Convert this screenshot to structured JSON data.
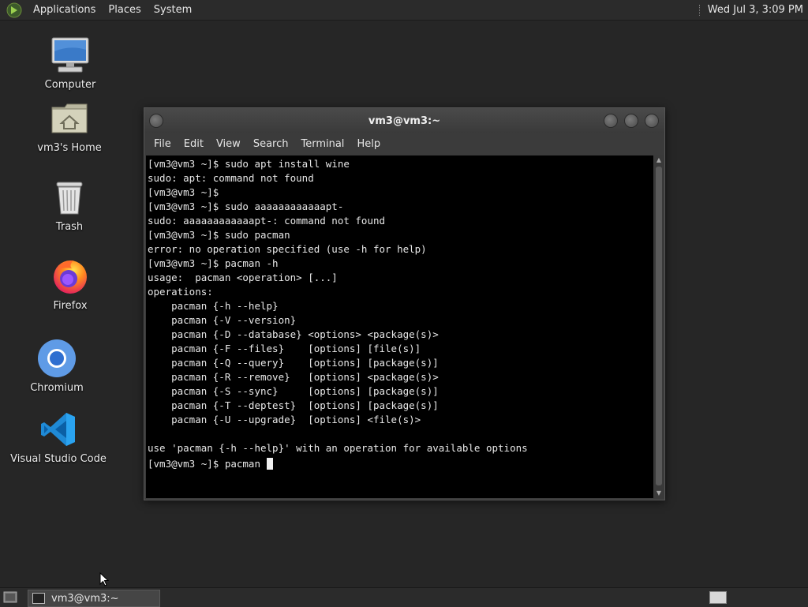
{
  "top_panel": {
    "menus": [
      "Applications",
      "Places",
      "System"
    ],
    "clock": "Wed Jul  3,  3:09 PM"
  },
  "desktop_icons": [
    {
      "label": "Computer",
      "icon": "computer-icon"
    },
    {
      "label": "vm3's Home",
      "icon": "home-folder-icon"
    },
    {
      "label": "Trash",
      "icon": "trash-icon"
    },
    {
      "label": "Firefox",
      "icon": "firefox-icon"
    },
    {
      "label": "Chromium",
      "icon": "chromium-icon"
    },
    {
      "label": "Visual Studio Code",
      "icon": "vscode-icon"
    }
  ],
  "terminal": {
    "title": "vm3@vm3:~",
    "menu": [
      "File",
      "Edit",
      "View",
      "Search",
      "Terminal",
      "Help"
    ],
    "lines": [
      "[vm3@vm3 ~]$ sudo apt install wine",
      "sudo: apt: command not found",
      "[vm3@vm3 ~]$",
      "[vm3@vm3 ~]$ sudo aaaaaaaaaaaapt-",
      "sudo: aaaaaaaaaaaapt-: command not found",
      "[vm3@vm3 ~]$ sudo pacman",
      "error: no operation specified (use -h for help)",
      "[vm3@vm3 ~]$ pacman -h",
      "usage:  pacman <operation> [...]",
      "operations:",
      "    pacman {-h --help}",
      "    pacman {-V --version}",
      "    pacman {-D --database} <options> <package(s)>",
      "    pacman {-F --files}    [options] [file(s)]",
      "    pacman {-Q --query}    [options] [package(s)]",
      "    pacman {-R --remove}   [options] <package(s)>",
      "    pacman {-S --sync}     [options] [package(s)]",
      "    pacman {-T --deptest}  [options] [package(s)]",
      "    pacman {-U --upgrade}  [options] <file(s)>",
      "",
      "use 'pacman {-h --help}' with an operation for available options"
    ],
    "prompt_line": "[vm3@vm3 ~]$ pacman "
  },
  "taskbar": {
    "task_label": "vm3@vm3:~"
  }
}
